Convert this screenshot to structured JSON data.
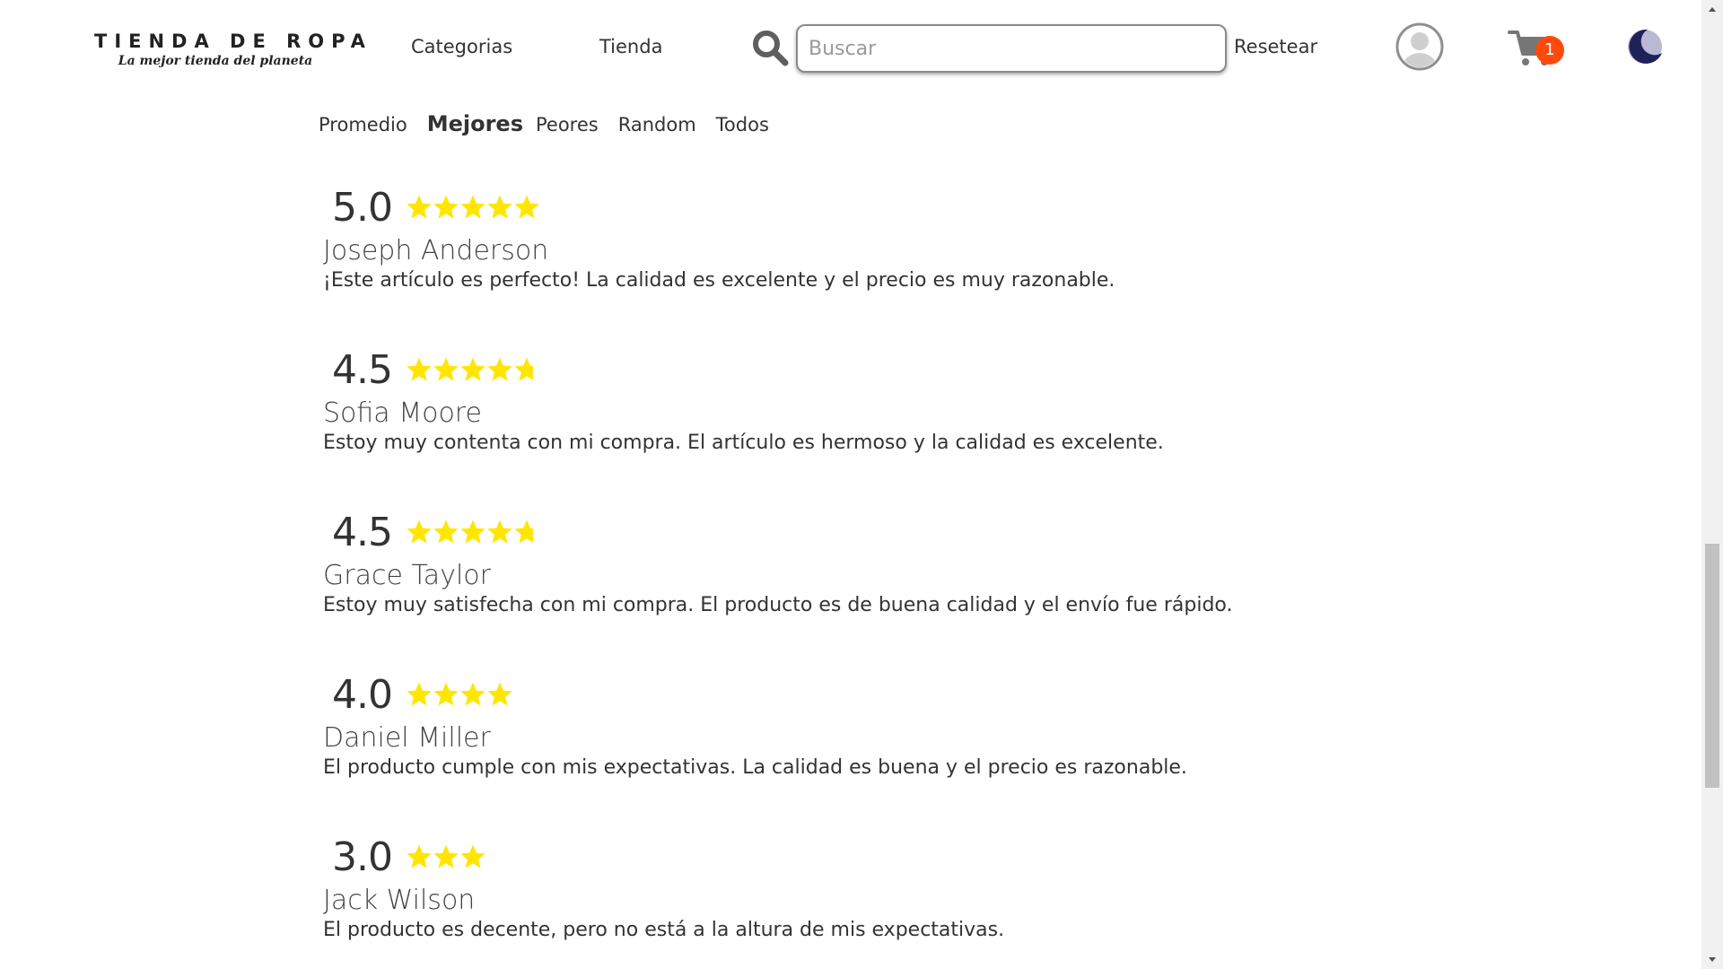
{
  "header": {
    "logo_title": "TIENDA DE ROPA",
    "logo_tagline": "La mejor tienda del planeta",
    "nav": {
      "categorias": "Categorias",
      "tienda": "Tienda"
    },
    "search": {
      "placeholder": "Buscar",
      "value": ""
    },
    "reset_label": "Resetear",
    "cart_count": "1",
    "icons": {
      "search": "search-icon",
      "avatar": "user-avatar-icon",
      "cart": "shopping-cart-icon",
      "theme": "moon-icon"
    }
  },
  "sort_tabs": [
    {
      "label": "Promedio",
      "active": false
    },
    {
      "label": "Mejores",
      "active": true
    },
    {
      "label": "Peores",
      "active": false
    },
    {
      "label": "Random",
      "active": false
    },
    {
      "label": "Todos",
      "active": false
    }
  ],
  "reviews": [
    {
      "score": "5.0",
      "rating": 5.0,
      "name": "Joseph Anderson",
      "comment": "¡Este artículo es perfecto! La calidad es excelente y el precio es muy razonable."
    },
    {
      "score": "4.5",
      "rating": 4.5,
      "name": "Sofia Moore",
      "comment": "Estoy muy contenta con mi compra. El artículo es hermoso y la calidad es excelente."
    },
    {
      "score": "4.5",
      "rating": 4.5,
      "name": "Grace Taylor",
      "comment": "Estoy muy satisfecha con mi compra. El producto es de buena calidad y el envío fue rápido."
    },
    {
      "score": "4.0",
      "rating": 4.0,
      "name": "Daniel Miller",
      "comment": "El producto cumple con mis expectativas. La calidad es buena y el precio es razonable."
    },
    {
      "score": "3.0",
      "rating": 3.0,
      "name": "Jack Wilson",
      "comment": "El producto es decente, pero no está a la altura de mis expectativas."
    }
  ],
  "colors": {
    "star": "#ffe600",
    "badge": "#ff4a0e",
    "text": "#333333",
    "moon": "#1f2258"
  }
}
